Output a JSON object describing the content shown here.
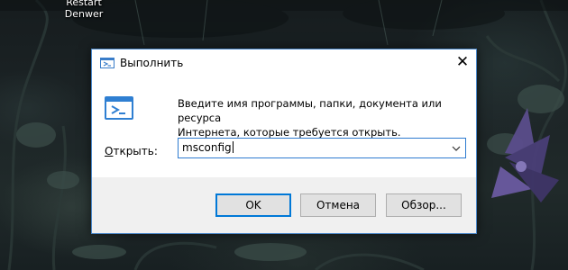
{
  "desktop": {
    "icon_label_line1": "Restart",
    "icon_label_line2": "Denwer"
  },
  "dialog": {
    "title": "Выполнить",
    "title_icon": "run-icon",
    "close_glyph": "✕",
    "description_line1": "Введите имя программы, папки, документа или ресурса",
    "description_line2": "Интернета, которые требуется открыть.",
    "open_label_accel": "О",
    "open_label_rest": "ткрыть:",
    "open_value": "msconfig",
    "buttons": {
      "ok": "OK",
      "cancel": "Отмена",
      "browse": "Обзор..."
    }
  },
  "colors": {
    "accent": "#0078d7",
    "button_face": "#e1e1e1",
    "footer_bg": "#f0f0f0"
  }
}
